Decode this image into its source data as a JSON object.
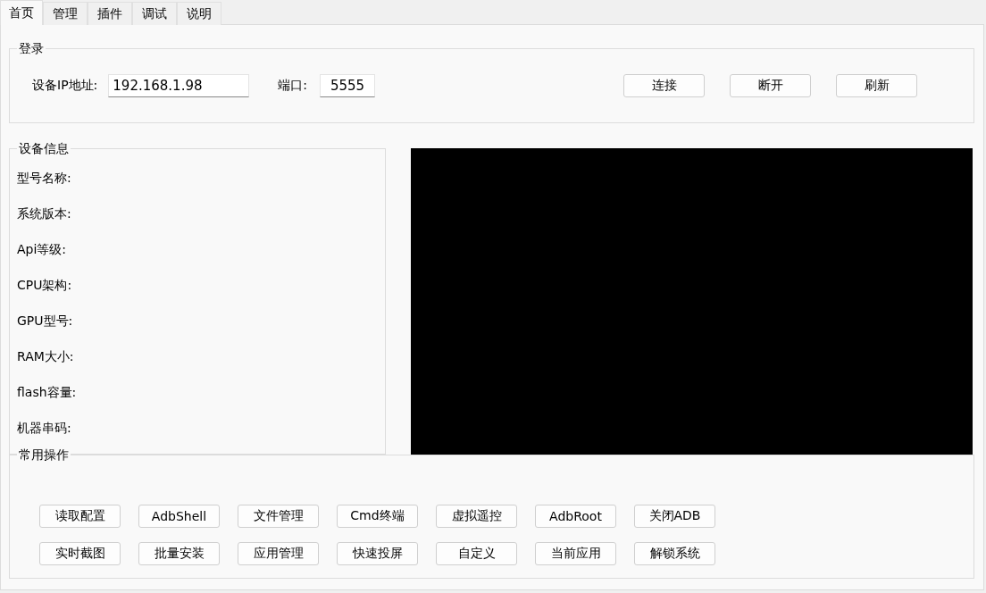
{
  "tabs": [
    {
      "label": "首页",
      "selected": true
    },
    {
      "label": "管理",
      "selected": false
    },
    {
      "label": "插件",
      "selected": false
    },
    {
      "label": "调试",
      "selected": false
    },
    {
      "label": "说明",
      "selected": false
    }
  ],
  "login": {
    "title": "登录",
    "ip_label": "设备IP地址:",
    "ip_value": "192.168.1.98",
    "port_label": "端口:",
    "port_value": "5555",
    "buttons": [
      "连接",
      "断开",
      "刷新"
    ]
  },
  "device_info": {
    "title": "设备信息",
    "fields": [
      "型号名称:",
      "系统版本:",
      "Api等级:",
      "CPU架构:",
      "GPU型号:",
      "RAM大小:",
      "flash容量:",
      "机器串码:"
    ]
  },
  "common_actions": {
    "title": "常用操作",
    "rows": [
      [
        "读取配置",
        "AdbShell",
        "文件管理",
        "Cmd终端",
        "虚拟遥控",
        "AdbRoot",
        "关闭ADB"
      ],
      [
        "实时截图",
        "批量安装",
        "应用管理",
        "快速投屏",
        "自定义",
        "当前应用",
        "解锁系统"
      ]
    ]
  }
}
